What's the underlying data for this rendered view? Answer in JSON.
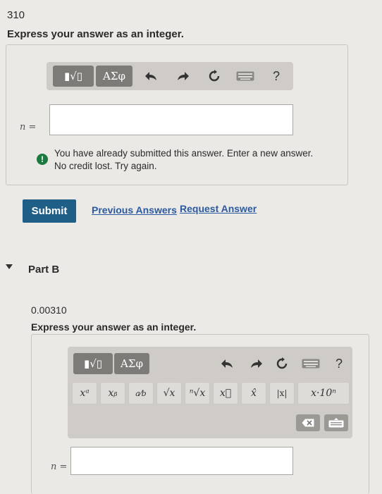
{
  "partA": {
    "value_text": "310",
    "instruction": "Express your answer as an integer.",
    "toolbar": {
      "templates_label": "▮√▯",
      "greek_label": "ΑΣφ",
      "help_label": "?"
    },
    "variable_label": "n =",
    "answer_value": "",
    "feedback_line1": "You have already submitted this answer. Enter a new answer.",
    "feedback_line2": "No credit lost. Try again.",
    "feedback_icon": "!",
    "submit_label": "Submit",
    "previous_answers_label": "Previous Answers",
    "request_answer_label": "Request Answer"
  },
  "partB": {
    "title": "Part B",
    "value_text": "0.00310",
    "instruction": "Express your answer as an integer.",
    "toolbar": {
      "templates_label": "▮√▯",
      "greek_label": "ΑΣφ",
      "help_label": "?"
    },
    "math_buttons": [
      "xᵃ",
      "xᵦ",
      "a⁄b",
      "√x",
      "ⁿ√x",
      "x⃗",
      "x̂",
      "|x|",
      "x·10ⁿ"
    ],
    "variable_label": "n =",
    "answer_value": ""
  },
  "colors": {
    "submit_bg": "#1f5e86",
    "link": "#2b5aa0",
    "feedback_icon": "#1b7a3f"
  }
}
